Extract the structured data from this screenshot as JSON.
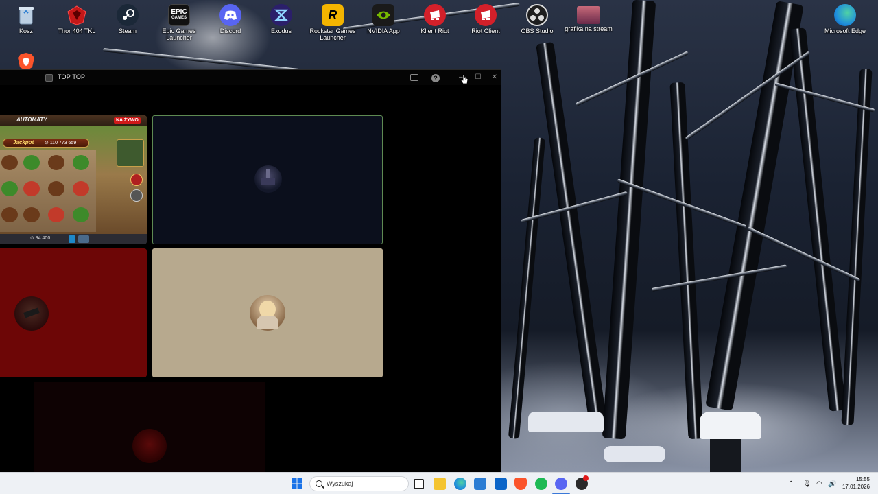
{
  "desktop": {
    "icons": [
      {
        "label": "Kosz",
        "icon": "recycle-bin-icon",
        "color": "#8aa9c9"
      },
      {
        "label": "Thor 404 TKL",
        "icon": "thor-keyboard-icon",
        "color": "#d51e1e"
      },
      {
        "label": "Steam",
        "icon": "steam-icon",
        "color": "#1b2838"
      },
      {
        "label": "Epic Games Launcher",
        "icon": "epic-games-icon",
        "color": "#111111"
      },
      {
        "label": "Discord",
        "icon": "discord-icon",
        "color": "#5865f2"
      },
      {
        "label": "Exodus",
        "icon": "exodus-icon",
        "color": "#3a2a8a"
      },
      {
        "label": "Rockstar Games Launcher",
        "icon": "rockstar-icon",
        "color": "#f3b400"
      },
      {
        "label": "NVIDIA App",
        "icon": "nvidia-icon",
        "color": "#76b900"
      },
      {
        "label": "Klient Riot",
        "icon": "riot-client-icon",
        "color": "#d3202a"
      },
      {
        "label": "Riot Client",
        "icon": "riot-client-icon",
        "color": "#d3202a"
      },
      {
        "label": "OBS Studio",
        "icon": "obs-icon",
        "color": "#2a2a2a"
      },
      {
        "label": "grafika na stream",
        "icon": "image-file-icon",
        "color": "#a2475a"
      },
      {
        "label": "Microsoft Edge",
        "icon": "edge-icon",
        "color": "#1f8fdc"
      },
      {
        "label": "",
        "icon": "brave-icon",
        "color": "#fb542b"
      }
    ]
  },
  "window": {
    "title": "TOP TOP",
    "controls": {
      "minimize": "—",
      "maximize": "☐",
      "close": "✕",
      "help": "?"
    }
  },
  "tiles": {
    "slot": {
      "category": "AUTOMATY",
      "live_badge": "NA ŻYWO",
      "jackpot_label": "Jackpot",
      "jackpot_amount": "⊙ 110 773 659",
      "balance": "⊙ 94 400"
    }
  },
  "taskbar": {
    "search_placeholder": "Wyszukaj",
    "time": "15:55",
    "date": "17.01.2026",
    "apps": [
      {
        "name": "start-button",
        "color": "#1a73e8"
      },
      {
        "name": "task-view-icon",
        "color": "#222222"
      },
      {
        "name": "file-explorer-icon",
        "color": "#f4c430"
      },
      {
        "name": "edge-icon",
        "color": "#1f8fdc"
      },
      {
        "name": "store-icon",
        "color": "#2b7cd3"
      },
      {
        "name": "outlook-icon",
        "color": "#0a64c8"
      },
      {
        "name": "brave-icon",
        "color": "#fb542b"
      },
      {
        "name": "spotify-icon",
        "color": "#1db954"
      },
      {
        "name": "discord-icon",
        "color": "#5865f2"
      },
      {
        "name": "obs-icon",
        "color": "#2a2a2a"
      }
    ]
  }
}
